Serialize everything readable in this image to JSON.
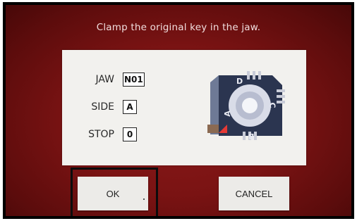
{
  "instruction": "Clamp the original key in the jaw.",
  "settings": [
    {
      "label": "JAW",
      "value": "N01"
    },
    {
      "label": "SIDE",
      "value": "A"
    },
    {
      "label": "STOP",
      "value": "0"
    }
  ],
  "diagram": {
    "sides": [
      "A",
      "B",
      "C",
      "D"
    ]
  },
  "buttons": {
    "ok": "OK",
    "cancel": "CANCEL"
  },
  "colors": {
    "background": "#7a1313",
    "panel": "#f2f1ee",
    "jaw_body": "#2b3550",
    "jaw_disc": "#d9dce8",
    "stop_marker": "#e53935"
  }
}
